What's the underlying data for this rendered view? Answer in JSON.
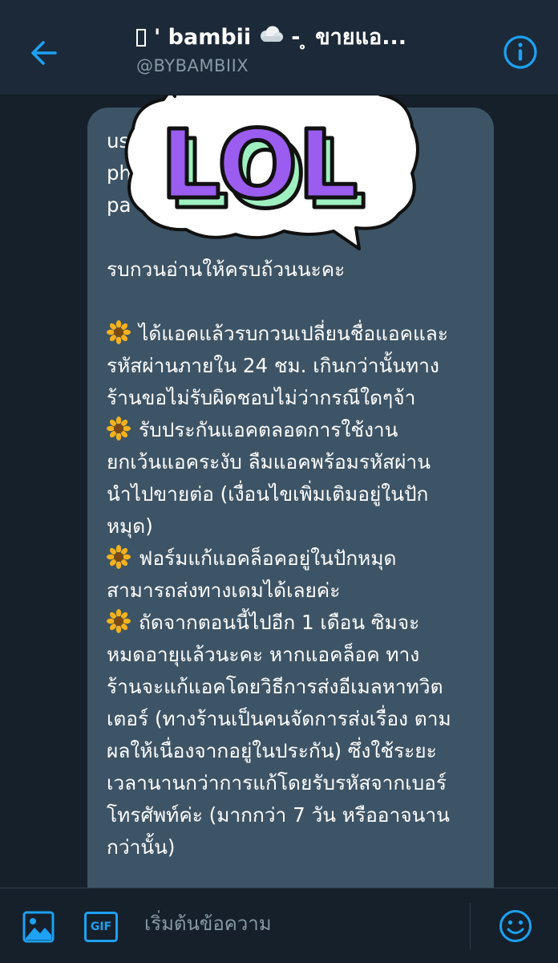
{
  "header": {
    "title_name": "' bambii",
    "title_suffix": "- ̥ ขายแอ...",
    "handle": "@BYBAMBIIX"
  },
  "sticker": {
    "text": "LOL"
  },
  "message": {
    "lines": [
      "us",
      "ph",
      "pa",
      "",
      "รบกวนอ่านให้ครบถ้วนนะคะ",
      "",
      "ได้แอคแล้วรบกวนเปลี่ยนชื่อแอคและ",
      "รหัสผ่านภายใน 24 ชม. เกินกว่านั้นทาง",
      "ร้านขอไม่รับผิดชอบไม่ว่ากรณีใดๆจ้า",
      "รับประกันแอคตลอดการใช้งาน",
      "ยกเว้นแอคระงับ ลืมแอคพร้อมรหัสผ่าน",
      "นำไปขายต่อ (เงื่อนไขเพิ่มเติมอยู่ในปัก",
      "หมุด)",
      "ฟอร์มแก้แอคล็อคอยู่ในปักหมุด",
      "สามารถส่งทางเดมได้เลยค่ะ",
      "ถัดจากตอนนี้ไปอีก 1 เดือน ซิมจะ",
      "หมดอายุแล้วนะคะ หากแอคล็อค ทาง",
      "ร้านจะแก้แอคโดยวิธีการส่งอีเมลหาทวิต",
      "เตอร์ (ทางร้านเป็นคนจัดการส่งเรื่อง ตาม",
      "ผลให้เนื่องจากอยู่ในประกัน) ซึ่งใช้ระยะ",
      "เวลานานกว่าการแก้โดยรับรหัสจากเบอร์",
      "โทรศัพท์ค่ะ (มากกว่า 7 วัน หรืออาจนาน",
      "กว่านั้น)"
    ]
  },
  "composer": {
    "placeholder": "เริ่มต้นข้อความ",
    "gif_label": "GIF"
  },
  "colors": {
    "accent": "#1da1f2",
    "background": "#15202b",
    "header": "#1c2938",
    "bubble": "#3d5466",
    "sticker_purple": "#9b5cf0",
    "sticker_green": "#9ef0c0"
  },
  "icons": {
    "back": "arrow-left-icon",
    "info": "info-icon",
    "title_cloud": "cloud-emoji-icon",
    "bullet": "sunflower-emoji-icon",
    "image": "image-icon",
    "gif": "gif-icon",
    "emoji": "smiley-icon"
  }
}
